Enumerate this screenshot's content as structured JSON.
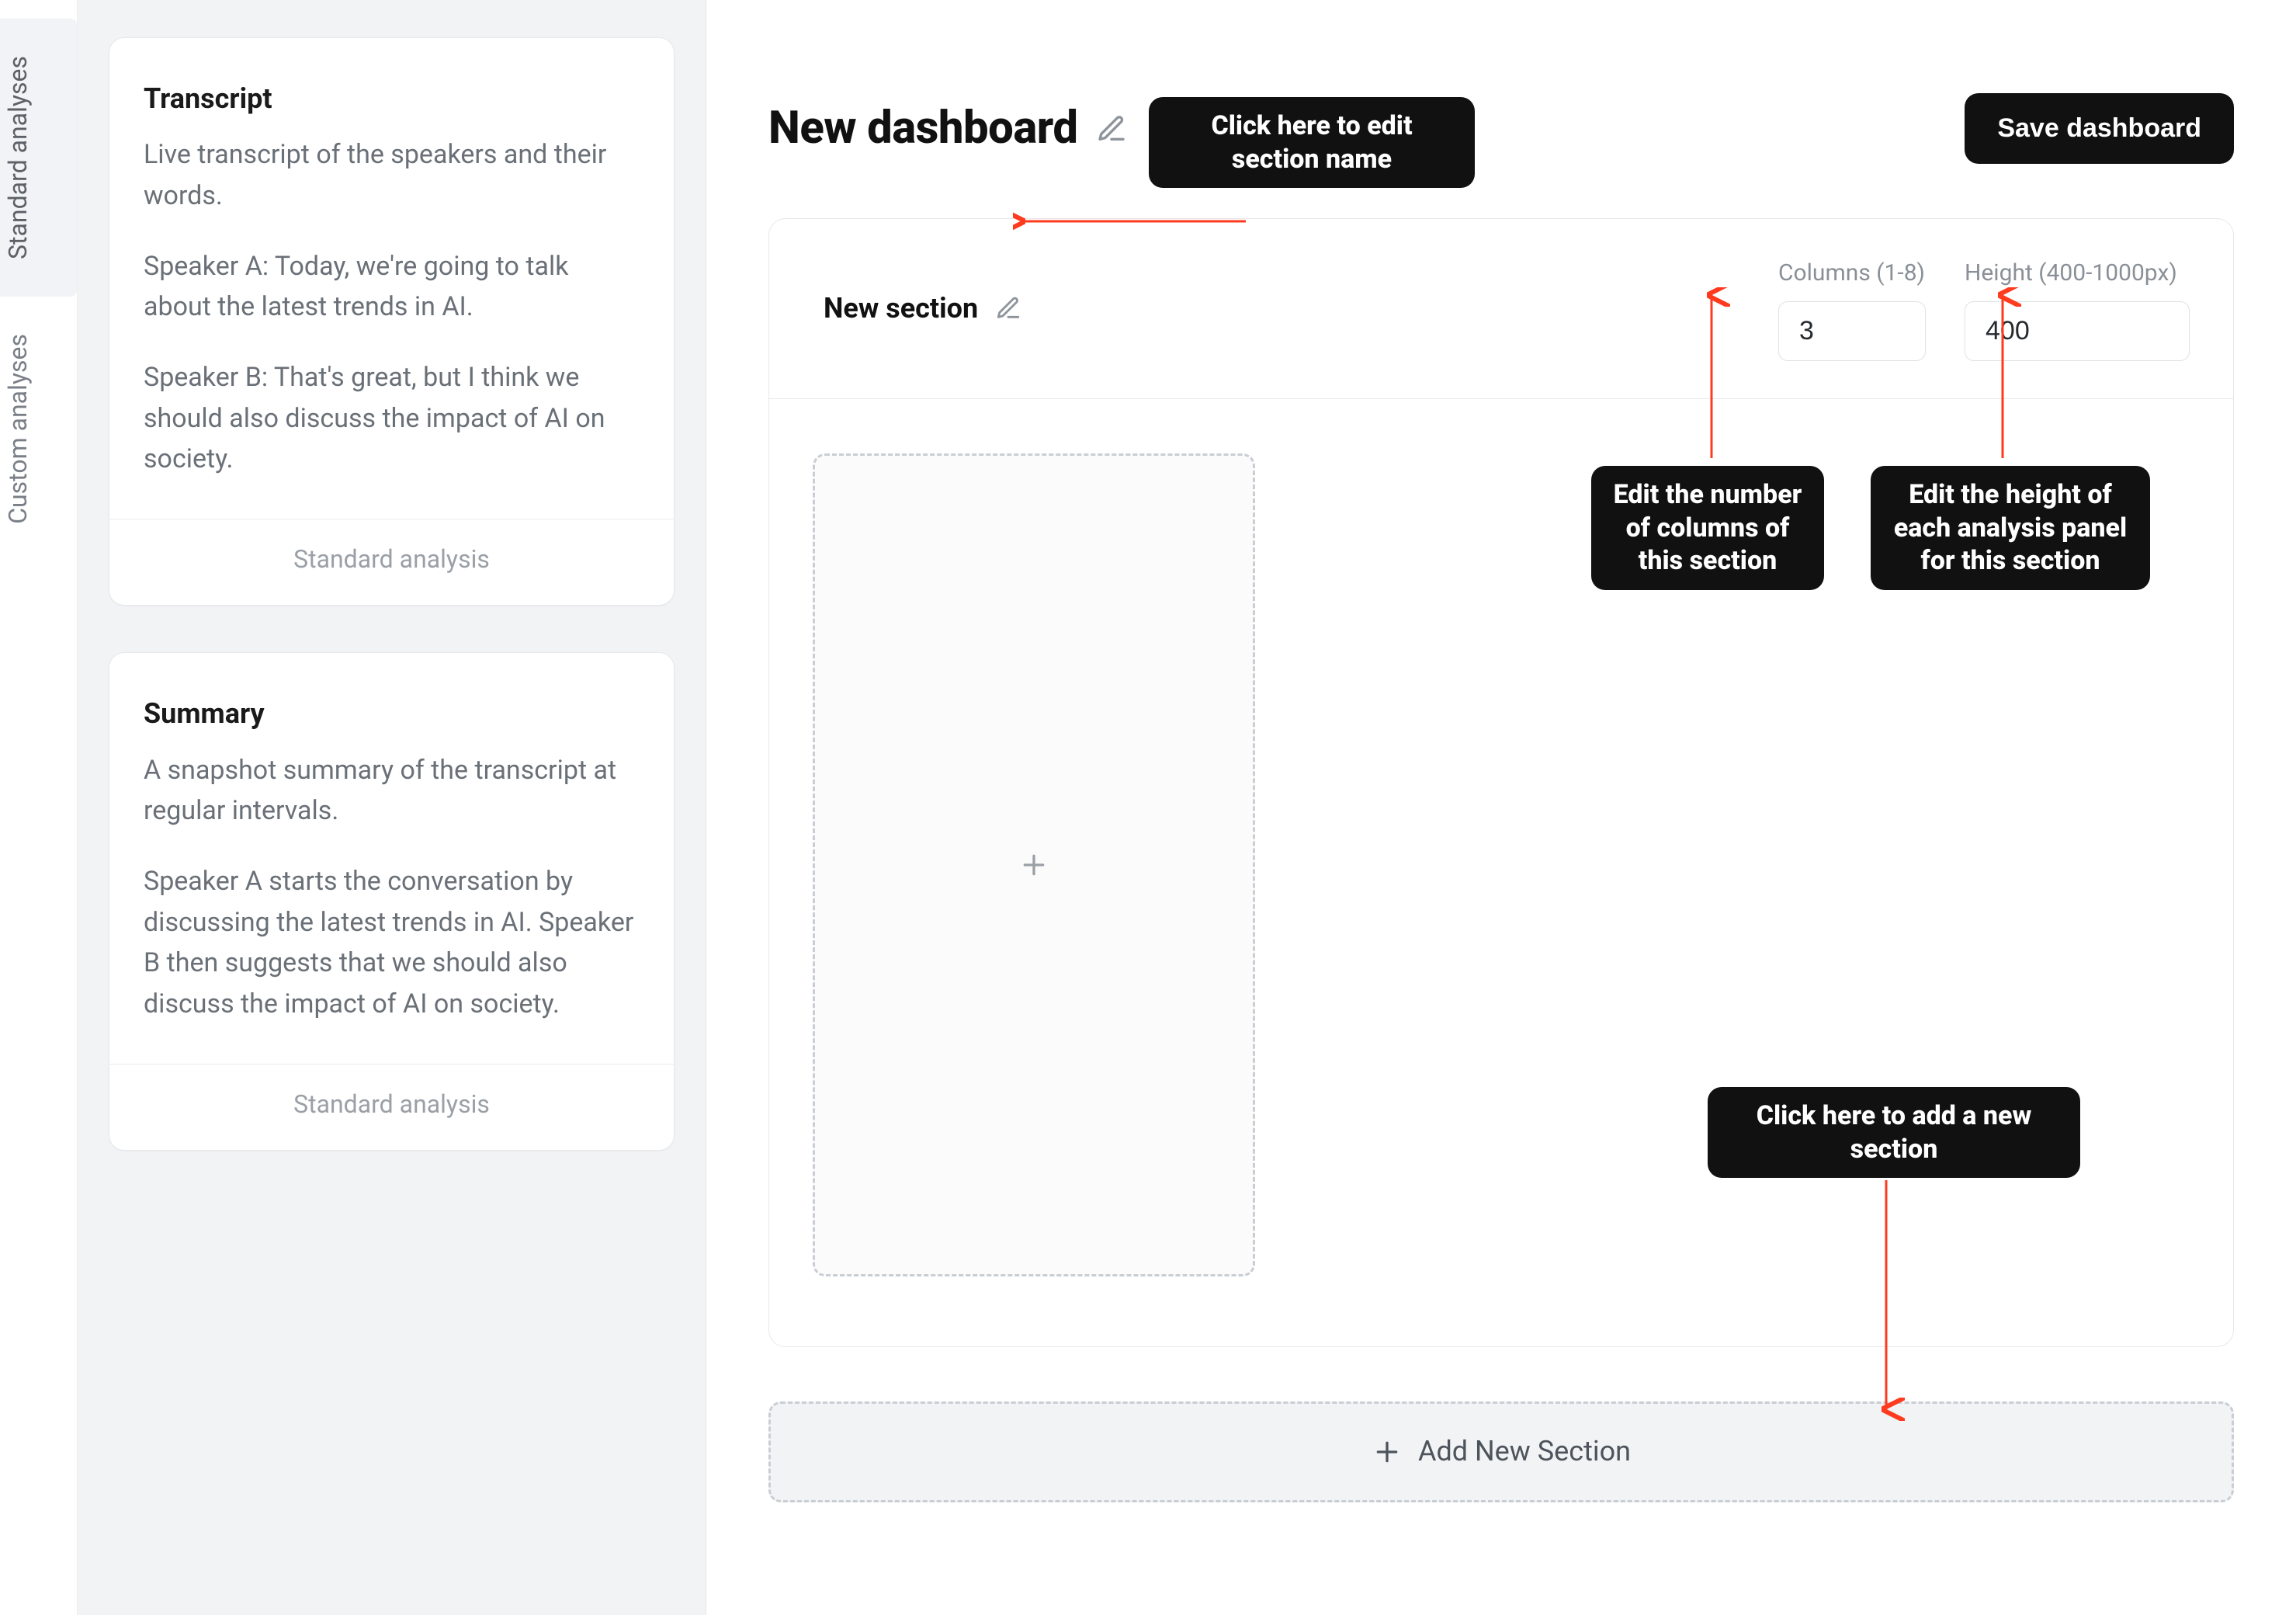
{
  "colors": {
    "accent": "#ff3b1f",
    "callout_bg": "#111111",
    "callout_fg": "#ffffff",
    "border": "#e6e8eb",
    "muted_text": "#6a7077"
  },
  "rail": {
    "tabs": [
      {
        "id": "standard",
        "label": "Standard analyses",
        "active": true
      },
      {
        "id": "custom",
        "label": "Custom analyses",
        "active": false
      }
    ]
  },
  "sidebar": {
    "cards": [
      {
        "id": "transcript",
        "title": "Transcript",
        "desc": "Live transcript of the speakers and their words.",
        "paragraphs": [
          "Speaker A: Today, we're going to talk about the latest trends in AI.",
          "Speaker B: That's great, but I think we should also discuss the impact of AI on society."
        ],
        "footer": "Standard analysis"
      },
      {
        "id": "summary",
        "title": "Summary",
        "desc": "A snapshot summary of the transcript at regular intervals.",
        "paragraphs": [
          "Speaker A starts the conversation by discussing the latest trends in AI. Speaker B then suggests that we should also discuss the impact of AI on society."
        ],
        "footer": "Standard analysis"
      }
    ]
  },
  "page": {
    "title": "New dashboard",
    "save_button": "Save dashboard",
    "pencil_icon": "pencil-icon"
  },
  "section": {
    "name": "New section",
    "columns_label": "Columns (1-8)",
    "columns_value": "3",
    "height_label": "Height (400-1000px)",
    "height_value": "400"
  },
  "add_section_label": "Add New Section",
  "callouts": {
    "edit_name": "Click here to edit section name",
    "columns": "Edit the number of columns of this section",
    "height": "Edit the height of each analysis panel for this section",
    "add_section": "Click here to add a new section"
  },
  "icons": {
    "plus": "plus-icon",
    "pencil": "pencil-icon"
  }
}
